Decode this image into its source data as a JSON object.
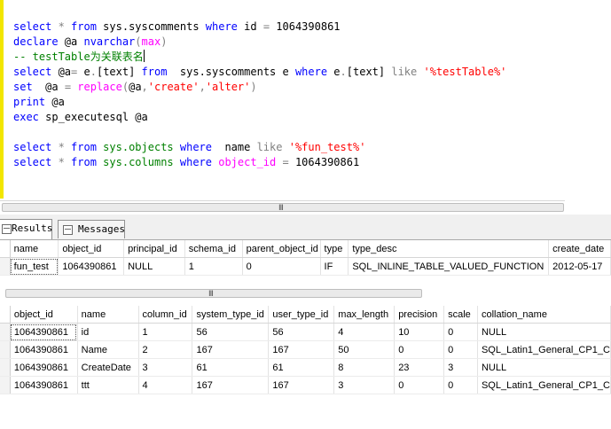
{
  "editor": {
    "lines": [
      [
        [
          "kw",
          "select"
        ],
        [
          "op",
          " * "
        ],
        [
          "kw",
          "from"
        ],
        [
          "plain",
          " sys.syscomments "
        ],
        [
          "kw",
          "where"
        ],
        [
          "plain",
          " id "
        ],
        [
          "op",
          "="
        ],
        [
          "plain",
          " 1064390861"
        ]
      ],
      [
        [
          "kw",
          "declare"
        ],
        [
          "plain",
          " @a "
        ],
        [
          "kw",
          "nvarchar"
        ],
        [
          "op",
          "("
        ],
        [
          "fn",
          "max"
        ],
        [
          "op",
          ")"
        ]
      ],
      [
        [
          "cm",
          "-- testTable为关联表名"
        ]
      ],
      [
        [
          "kw",
          "select"
        ],
        [
          "plain",
          " @a"
        ],
        [
          "op",
          "="
        ],
        [
          "plain",
          " e"
        ],
        [
          "op",
          "."
        ],
        [
          "plain",
          "[text] "
        ],
        [
          "kw",
          "from"
        ],
        [
          "plain",
          "  sys.syscomments e "
        ],
        [
          "kw",
          "where"
        ],
        [
          "plain",
          " e"
        ],
        [
          "op",
          "."
        ],
        [
          "plain",
          "[text] "
        ],
        [
          "op",
          "like"
        ],
        [
          "plain",
          " "
        ],
        [
          "str",
          "'%testTable%'"
        ]
      ],
      [
        [
          "kw",
          "set"
        ],
        [
          "plain",
          "  @a "
        ],
        [
          "op",
          "="
        ],
        [
          "plain",
          " "
        ],
        [
          "fn",
          "replace"
        ],
        [
          "op",
          "("
        ],
        [
          "plain",
          "@a"
        ],
        [
          "op",
          ","
        ],
        [
          "str",
          "'create'"
        ],
        [
          "op",
          ","
        ],
        [
          "str",
          "'alter'"
        ],
        [
          "op",
          ")"
        ]
      ],
      [
        [
          "kw",
          "print"
        ],
        [
          "plain",
          " @a"
        ]
      ],
      [
        [
          "kw",
          "exec"
        ],
        [
          "plain",
          " sp_executesql @a"
        ]
      ],
      [],
      [
        [
          "kw",
          "select"
        ],
        [
          "op",
          " * "
        ],
        [
          "kw",
          "from"
        ],
        [
          "ob",
          " sys.objects "
        ],
        [
          "kw",
          "where"
        ],
        [
          "plain",
          "  name "
        ],
        [
          "op",
          "like"
        ],
        [
          "plain",
          " "
        ],
        [
          "str",
          "'%fun_test%'"
        ]
      ],
      [
        [
          "kw",
          "select"
        ],
        [
          "op",
          " * "
        ],
        [
          "kw",
          "from"
        ],
        [
          "ob",
          " sys.columns "
        ],
        [
          "kw",
          "where"
        ],
        [
          "plain",
          " "
        ],
        [
          "fn",
          "object_id"
        ],
        [
          "plain",
          " "
        ],
        [
          "op",
          "="
        ],
        [
          "plain",
          " 1064390861"
        ]
      ]
    ]
  },
  "tabs": {
    "results": "Results",
    "messages": "Messages"
  },
  "grid1": {
    "columns": [
      "name",
      "object_id",
      "principal_id",
      "schema_id",
      "parent_object_id",
      "type",
      "type_desc",
      "create_date"
    ],
    "rows": [
      [
        "fun_test",
        "1064390861",
        "NULL",
        "1",
        "0",
        "IF",
        "SQL_INLINE_TABLE_VALUED_FUNCTION",
        "2012-05-17"
      ]
    ]
  },
  "grid2": {
    "columns": [
      "object_id",
      "name",
      "column_id",
      "system_type_id",
      "user_type_id",
      "max_length",
      "precision",
      "scale",
      "collation_name"
    ],
    "rows": [
      [
        "1064390861",
        "id",
        "1",
        "56",
        "56",
        "4",
        "10",
        "0",
        "NULL"
      ],
      [
        "1064390861",
        "Name",
        "2",
        "167",
        "167",
        "50",
        "0",
        "0",
        "SQL_Latin1_General_CP1_C"
      ],
      [
        "1064390861",
        "CreateDate",
        "3",
        "61",
        "61",
        "8",
        "23",
        "3",
        "NULL"
      ],
      [
        "1064390861",
        "ttt",
        "4",
        "167",
        "167",
        "3",
        "0",
        "0",
        "SQL_Latin1_General_CP1_C"
      ]
    ]
  },
  "scroll_grip": "III"
}
